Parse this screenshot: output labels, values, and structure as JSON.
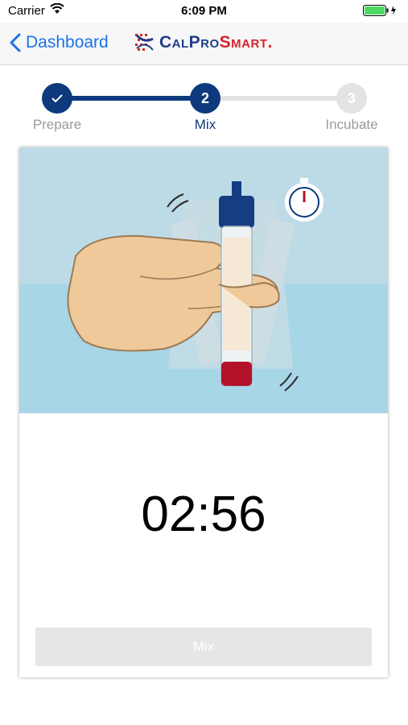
{
  "status_bar": {
    "carrier": "Carrier",
    "time": "6:09 PM"
  },
  "nav": {
    "back_label": "Dashboard",
    "logo_calpro": "CalPro",
    "logo_smart": "Smart."
  },
  "stepper": {
    "steps": [
      {
        "number": "",
        "label": "Prepare",
        "state": "complete"
      },
      {
        "number": "2",
        "label": "Mix",
        "state": "active"
      },
      {
        "number": "3",
        "label": "Incubate",
        "state": "pending"
      }
    ]
  },
  "main": {
    "timer": "02:56",
    "mix_button_label": "Mix"
  },
  "colors": {
    "primary": "#0e3a7d",
    "inactive": "#e3e3e3",
    "inactive_text": "#bdbdbd",
    "back_link": "#1a73e8",
    "sky": "#bcdbe6",
    "water": "#a7d6e7",
    "cap": "#163d82",
    "sample_red": "#b3122a"
  },
  "icons": [
    "wifi-icon",
    "battery-icon",
    "chevron-left-icon",
    "calprosmart-logo",
    "checkmark-icon",
    "stopwatch-icon"
  ]
}
